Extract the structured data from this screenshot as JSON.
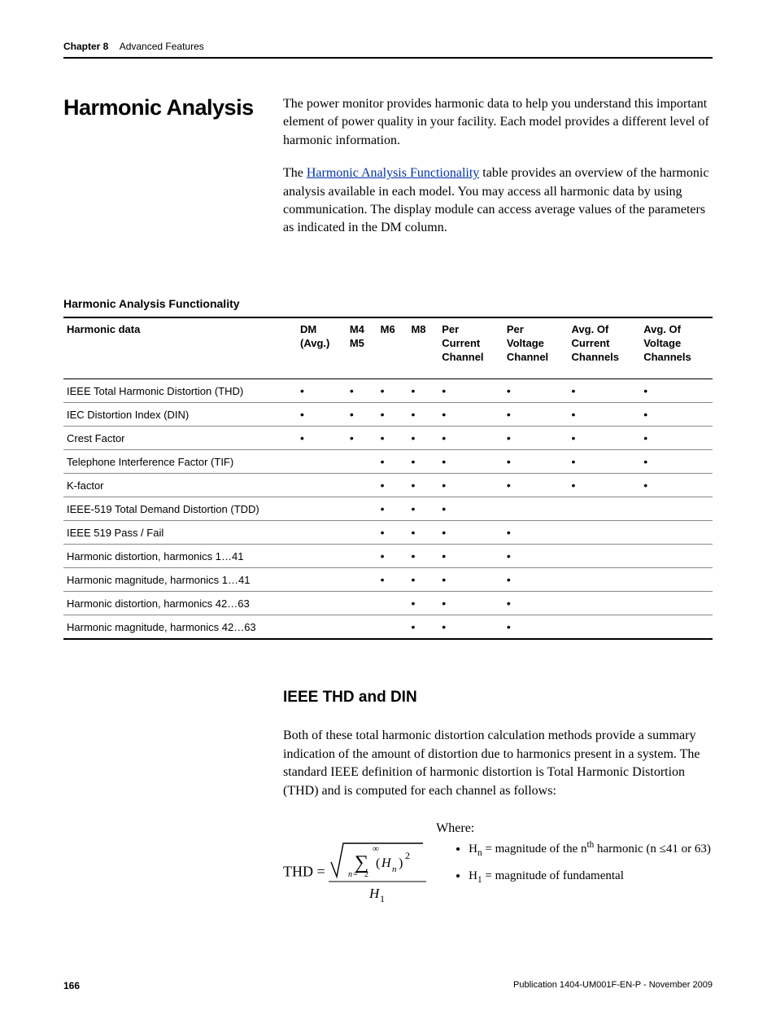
{
  "run_head": {
    "chapter_label": "Chapter 8",
    "chapter_title": "Advanced Features"
  },
  "section_title": "Harmonic Analysis",
  "intro_p1": "The power monitor provides harmonic data to help you understand this important element of power quality in your facility. Each model provides a different level of harmonic information.",
  "intro_p2_pre": "The ",
  "intro_p2_link": "Harmonic Analysis Functionality",
  "intro_p2_post": " table provides an overview of the harmonic analysis available in each model. You may access all harmonic data by using communication. The display module can access average values of the parameters as indicated in the DM column.",
  "table_title": "Harmonic Analysis Functionality",
  "columns": {
    "c0": "Harmonic data",
    "c1a": "DM",
    "c1b": "(Avg.)",
    "c2a": "M4",
    "c2b": "M5",
    "c3": "M6",
    "c4": "M8",
    "c5a": "Per",
    "c5b": "Current",
    "c5c": "Channel",
    "c6a": "Per",
    "c6b": "Voltage",
    "c6c": "Channel",
    "c7a": "Avg. Of",
    "c7b": "Current",
    "c7c": "Channels",
    "c8a": "Avg. Of",
    "c8b": "Voltage",
    "c8c": "Channels"
  },
  "rows": [
    {
      "label": "IEEE Total Harmonic Distortion (THD)",
      "m": [
        "•",
        "•",
        "•",
        "•",
        "•",
        "•",
        "•",
        "•"
      ]
    },
    {
      "label": "IEC Distortion Index (DIN)",
      "m": [
        "•",
        "•",
        "•",
        "•",
        "•",
        "•",
        "•",
        "•"
      ]
    },
    {
      "label": "Crest Factor",
      "m": [
        "•",
        "•",
        "•",
        "•",
        "•",
        "•",
        "•",
        "•"
      ]
    },
    {
      "label": "Telephone Interference Factor (TIF)",
      "m": [
        "",
        "",
        "•",
        "•",
        "•",
        "•",
        "•",
        "•"
      ]
    },
    {
      "label": "K-factor",
      "m": [
        "",
        "",
        "•",
        "•",
        "•",
        "•",
        "•",
        "•"
      ]
    },
    {
      "label": "IEEE-519 Total Demand Distortion (TDD)",
      "m": [
        "",
        "",
        "•",
        "•",
        "•",
        "",
        "",
        ""
      ]
    },
    {
      "label": "IEEE 519 Pass / Fail",
      "m": [
        "",
        "",
        "•",
        "•",
        "•",
        "•",
        "",
        ""
      ]
    },
    {
      "label": "Harmonic distortion, harmonics 1…41",
      "m": [
        "",
        "",
        "•",
        "•",
        "•",
        "•",
        "",
        ""
      ]
    },
    {
      "label": "Harmonic magnitude, harmonics 1…41",
      "m": [
        "",
        "",
        "•",
        "•",
        "•",
        "•",
        "",
        ""
      ]
    },
    {
      "label": "Harmonic distortion, harmonics 42…63",
      "m": [
        "",
        "",
        "",
        "•",
        "•",
        "•",
        "",
        ""
      ]
    },
    {
      "label": "Harmonic magnitude, harmonics 42…63",
      "m": [
        "",
        "",
        "",
        "•",
        "•",
        "•",
        "",
        ""
      ]
    }
  ],
  "subsection_title": "IEEE THD and DIN",
  "sub_p1": "Both of these total harmonic distortion calculation methods provide a summary indication of the amount of distortion due to harmonics present in a system. The standard IEEE definition of harmonic distortion is Total Harmonic Distortion (THD) and is computed for each channel as follows:",
  "formula": {
    "lhs": "THD",
    "eq": " = ",
    "sum_low_a": "n",
    "sum_low_b": " = ",
    "sum_low_c": "2",
    "sum_up": "∞",
    "term_open": "(",
    "term_H": "H",
    "term_n": "n",
    "term_close": ")",
    "term_pow": "2",
    "denom_H": "H",
    "denom_1": "1"
  },
  "where_label": "Where:",
  "where1_a": "H",
  "where1_b": "n",
  "where1_c": " = magnitude of the n",
  "where1_d": "th",
  "where1_e": " harmonic (n ≤41 or 63)",
  "where2_a": "H",
  "where2_b": "1",
  "where2_c": " = magnitude of fundamental",
  "footer": {
    "page": "166",
    "pub": "Publication 1404-UM001F-EN-P - November 2009"
  }
}
